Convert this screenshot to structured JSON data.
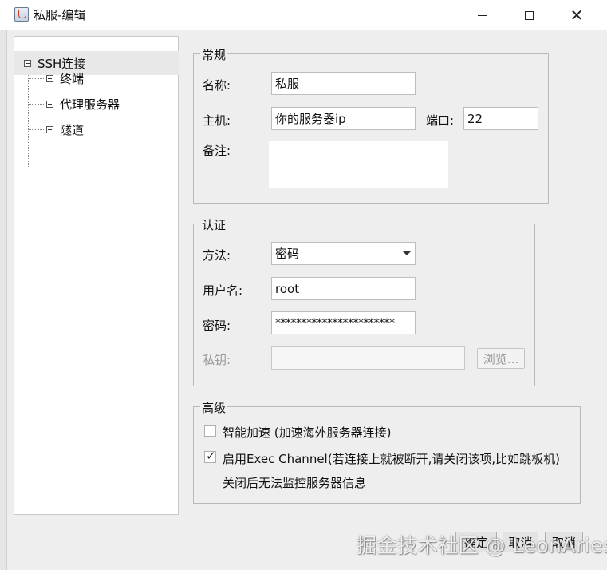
{
  "window": {
    "title": "私服-编辑",
    "minimize_glyph": "—",
    "close_glyph": "✕"
  },
  "tree": {
    "root": "SSH连接",
    "children": [
      "终端",
      "代理服务器",
      "隧道"
    ]
  },
  "general": {
    "legend": "常规",
    "name_label": "名称:",
    "name_value": "私服",
    "host_label": "主机:",
    "host_value": "你的服务器ip",
    "port_label": "端口:",
    "port_value": "22",
    "note_label": "备注:",
    "note_value": ""
  },
  "auth": {
    "legend": "认证",
    "method_label": "方法:",
    "method_value": "密码",
    "username_label": "用户名:",
    "username_value": "root",
    "password_label": "密码:",
    "password_value": "***********************",
    "key_label": "私钥:",
    "key_value": "",
    "browse_label": "浏览..."
  },
  "advanced": {
    "legend": "高级",
    "smart_accel_label": "智能加速 (加速海外服务器连接)",
    "smart_accel_checked": false,
    "exec_channel_label": "启用Exec Channel(若连接上就被断开,请关闭该项,比如跳板机)",
    "exec_channel_checked": true,
    "exec_channel_note": "关闭后无法监控服务器信息"
  },
  "buttons": {
    "ok": "确定",
    "cancel": "取消",
    "extra": "取消"
  },
  "watermark": "掘金技术社区 @ LeonAries",
  "icons": [
    "java-app-icon",
    "minimize-icon",
    "maximize-icon",
    "close-icon",
    "tree-collapse-icon",
    "dropdown-arrow-icon",
    "checkbox-icon"
  ]
}
